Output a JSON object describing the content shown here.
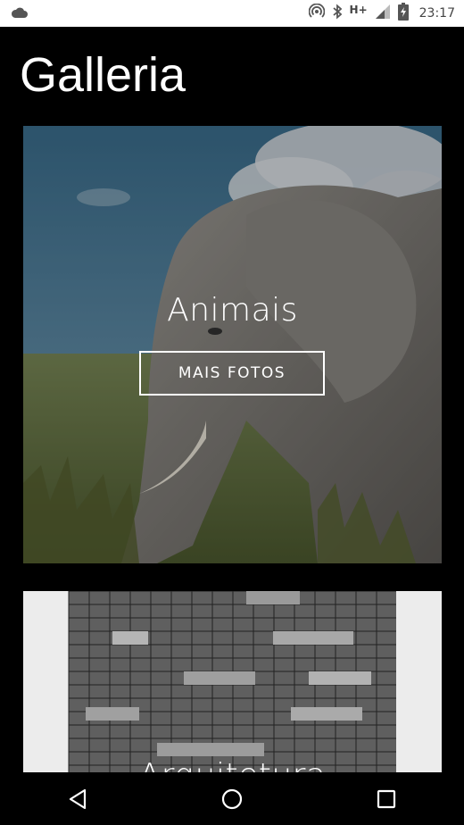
{
  "status_bar": {
    "network_type": "H+",
    "time": "23:17",
    "icons": [
      "cloud-icon",
      "hotspot-icon",
      "bluetooth-icon",
      "signal-icon",
      "battery-icon"
    ]
  },
  "app": {
    "title": "Galleria"
  },
  "cards": [
    {
      "title": "Animais",
      "button_label": "MAIS FOTOS"
    },
    {
      "title": "Arquitetura"
    }
  ],
  "nav_bar": {
    "icons": [
      "back-icon",
      "home-icon",
      "recents-icon"
    ]
  }
}
